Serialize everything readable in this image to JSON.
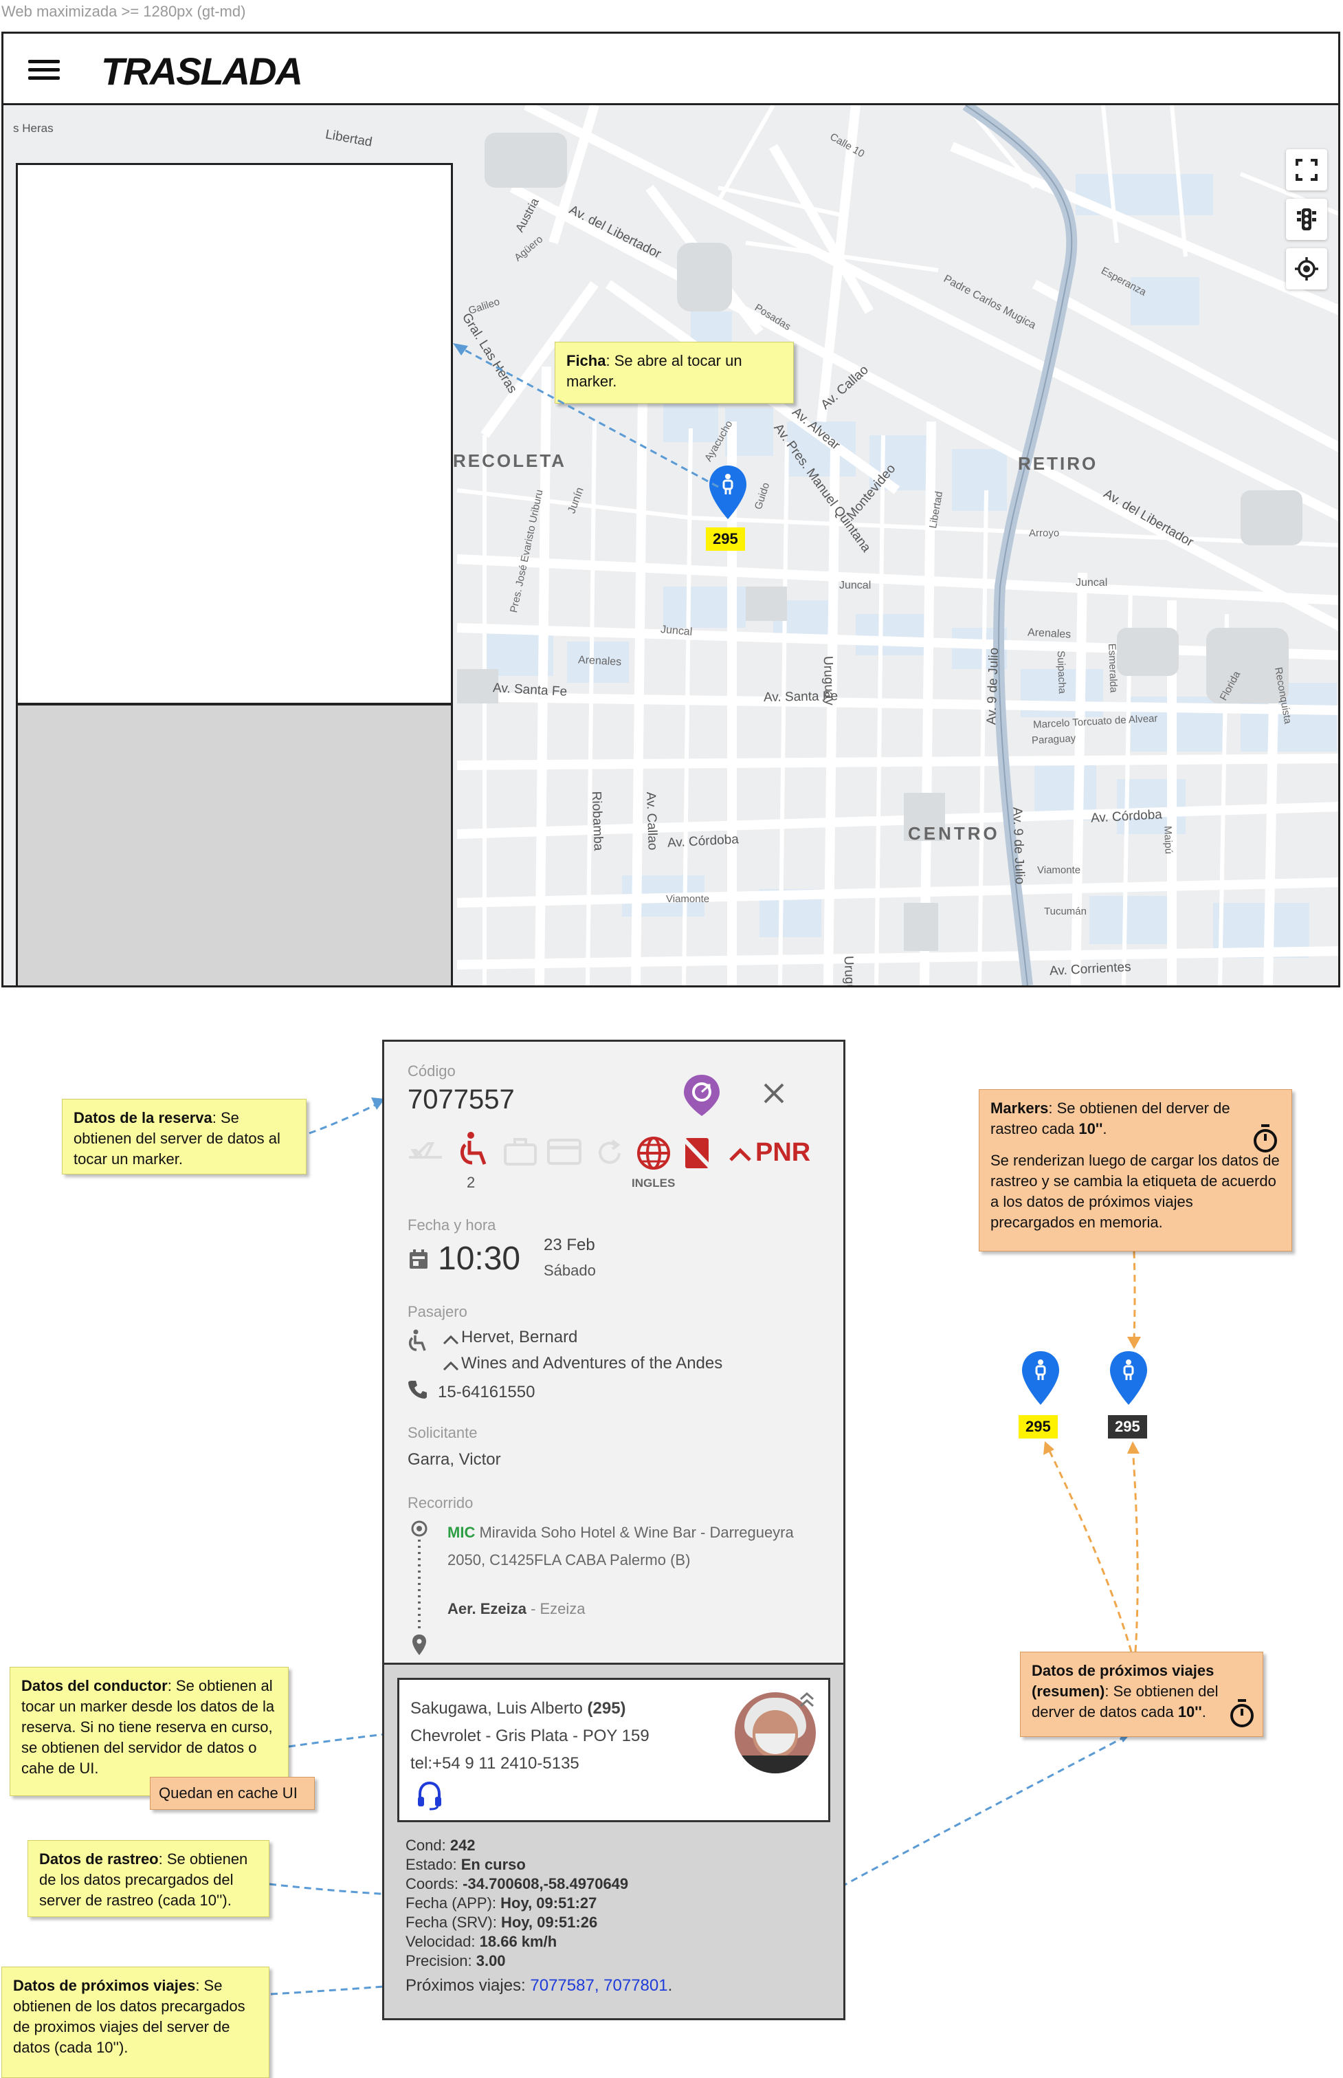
{
  "caption": "Web maximizada >= 1280px (gt-md)",
  "app": {
    "logo": "TRASLADA"
  },
  "map": {
    "districts": {
      "recoleta": "RECOLETA",
      "retiro": "RETIRO",
      "centro": "CENTRO"
    },
    "streets": {
      "santa_fe_1": "Av. Santa Fe",
      "santa_fe_2": "Av. Santa Fe",
      "cordoba_1": "Av. Córdoba",
      "cordoba_2": "Av. Córdoba",
      "corrientes": "Av. Corrientes",
      "libertador_1": "Av. del Libertador",
      "libertador_2": "Av. del Libertador",
      "callao_1": "Av. Callao",
      "callao_2": "Av. Callao",
      "alvear": "Av. Alvear",
      "quintana": "Av. Pres. Manuel Quintana",
      "montevideo_1": "Montevideo",
      "nueve_julio_1": "Av. 9 de Julio",
      "nueve_julio_2": "Av. 9 de Julio",
      "uruguay_1": "Uruguay",
      "uruguay_2": "Uruguay",
      "junin": "Junín",
      "arenales_1": "Arenales",
      "arenales_2": "Arenales",
      "juncal_1": "Juncal",
      "juncal_2": "Juncal",
      "juncal_3": "Juncal",
      "riobamba": "Riobamba",
      "las_heras": "Gral. Las Heras",
      "austria": "Austria",
      "carlos_mugica": "Padre Carlos Mugica",
      "esmeralda": "Esmeralda",
      "paraguay": "Paraguay",
      "viamonte_1": "Viamonte",
      "viamonte_2": "Viamonte",
      "tucuman": "Tucumán",
      "marcelo_alvear": "Marcelo Torcuato de Alvear",
      "suipacha": "Suipacha",
      "arroyo": "Arroyo",
      "libertad": "Libertad",
      "guido": "Guido",
      "ayacucho": "Ayacucho",
      "florida": "Florida",
      "reconquista": "Reconquista",
      "maipu": "Maipú",
      "esperanza": "Esperanza",
      "pres_uriburu": "Pres. José Evaristo Uriburu",
      "libertad_top": "Libertad",
      "heras_small": "s Heras",
      "posadas": "Posadas",
      "galileo": "Galileo",
      "aguero": "Agüero",
      "callao_small": "Callao",
      "calle10": "Calle 10"
    },
    "marker": {
      "label": "295"
    }
  },
  "notes": {
    "ficha": {
      "title": "Ficha",
      "text": ": Se abre al tocar un marker."
    },
    "reserva": {
      "title": "Datos de la reserva",
      "text": ": Se obtienen del server de datos al tocar un marker."
    },
    "markers": {
      "title": "Markers",
      "text1": ": Se obtienen del derver de rastreo cada ",
      "bold1": "10''",
      "end1": ".",
      "text2": "Se renderizan luego de cargar los datos de rastreo y se cambia la etiqueta de acuerdo a los datos de próximos viajes precargados en memoria."
    },
    "conductor": {
      "title": "Datos del conductor",
      "text": ": Se obtienen al tocar un marker desde los datos de la reserva. Si no tiene reserva en curso, se obtienen del servidor de datos o cahe de UI."
    },
    "cache": "Quedan en cache UI",
    "rastreo": {
      "title": "Datos de rastreo",
      "text": ": Se obtienen de los datos precargados del server de rastreo (cada 10'')."
    },
    "proximos": {
      "title": "Datos de próximos viajes",
      "text": ": Se obtienen de los datos precargados de proximos viajes del server de datos (cada 10'')."
    },
    "resumen": {
      "title": "Datos de próximos viajes (resumen)",
      "text": ": Se obtienen del derver de datos cada ",
      "bold": "10''",
      "end": "."
    }
  },
  "markers_demo": {
    "yellow": "295",
    "dark": "295"
  },
  "card": {
    "codigo_label": "Código",
    "codigo": "7077557",
    "pax_count": "2",
    "idioma": "INGLES",
    "pnr": "PNR",
    "fecha_label": "Fecha y hora",
    "hora": "10:30",
    "fecha": "23 Feb",
    "dia": "Sábado",
    "pasajero_label": "Pasajero",
    "pasajero": "Hervet, Bernard",
    "empresa": "Wines and Adventures of the Andes",
    "telefono": "15-64161550",
    "solicitante_label": "Solicitante",
    "solicitante": "Garra, Victor",
    "recorrido_label": "Recorrido",
    "origen_code": "MIC",
    "origen": "Miravida Soho Hotel & Wine Bar - Darregueyra 2050, C1425FLA CABA Palermo (B)",
    "destino_name": "Aer. Ezeiza",
    "destino_rest": " - Ezeiza"
  },
  "driver": {
    "name": "Sakugawa, Luis Alberto ",
    "id": "(295)",
    "car": "Chevrolet - Gris Plata - POY 159",
    "tel": "tel:+54 9 11 2410-5135"
  },
  "tracking": {
    "cond_label": "Cond: ",
    "cond": "242",
    "estado_label": "Estado: ",
    "estado": "En curso",
    "coords_label": "Coords: ",
    "coords": "-34.700608,-58.4970649",
    "fecha_app_label": "Fecha (APP): ",
    "fecha_app": "Hoy, 09:51:27",
    "fecha_srv_label": "Fecha (SRV): ",
    "fecha_srv": "Hoy, 09:51:26",
    "velocidad_label": "Velocidad: ",
    "velocidad": "18.66 km/h",
    "precision_label": "Precision: ",
    "precision": "3.00",
    "proximos_label": "Próximos viajes: ",
    "proximos": "7077587, 7077801",
    "proximos_end": "."
  },
  "colors": {
    "marker_blue": "#1a73e8",
    "pnr_red": "#c62828",
    "accent_purple": "#8e44ad",
    "note_yellow": "#fafa9e",
    "note_orange": "#f9c89b"
  }
}
